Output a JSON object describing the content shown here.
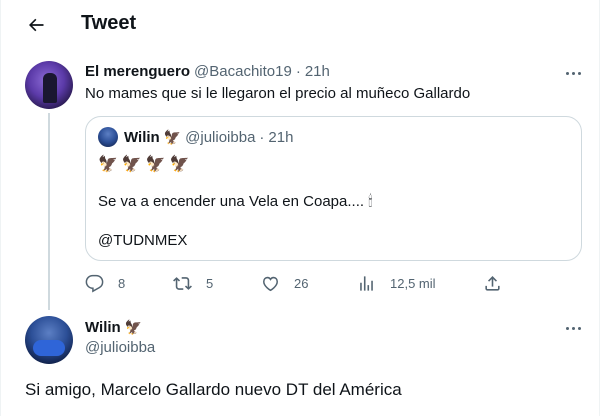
{
  "header": {
    "title": "Tweet"
  },
  "reply_tweet": {
    "display_name": "El merenguero",
    "handle": "@Bacachito19",
    "separator": "·",
    "time": "21h",
    "text": "No mames que si le llegaron el precio al muñeco Gallardo"
  },
  "quoted_tweet": {
    "display_name": "Wilin",
    "handle": "@julioibba",
    "separator": "·",
    "time": "21h",
    "emoji_line": "🦅🦅🦅🦅",
    "text": "Se va a encender una Vela en Coapa....",
    "text_emoji": "🕯",
    "mention": "@TUDNMEX"
  },
  "actions": {
    "replies": "8",
    "retweets": "5",
    "likes": "26",
    "views": "12,5 mil"
  },
  "main_tweet": {
    "display_name": "Wilin",
    "handle": "@julioibba",
    "text": "Si amigo, Marcelo Gallardo nuevo DT del América"
  },
  "colors": {
    "text": "#0f1419",
    "muted": "#536471",
    "border": "#cfd9de"
  },
  "icons": [
    "back-arrow-icon",
    "more-icon",
    "reply-icon",
    "retweet-icon",
    "like-icon",
    "views-icon",
    "share-icon",
    "eagle-icon",
    "candle-icon"
  ]
}
